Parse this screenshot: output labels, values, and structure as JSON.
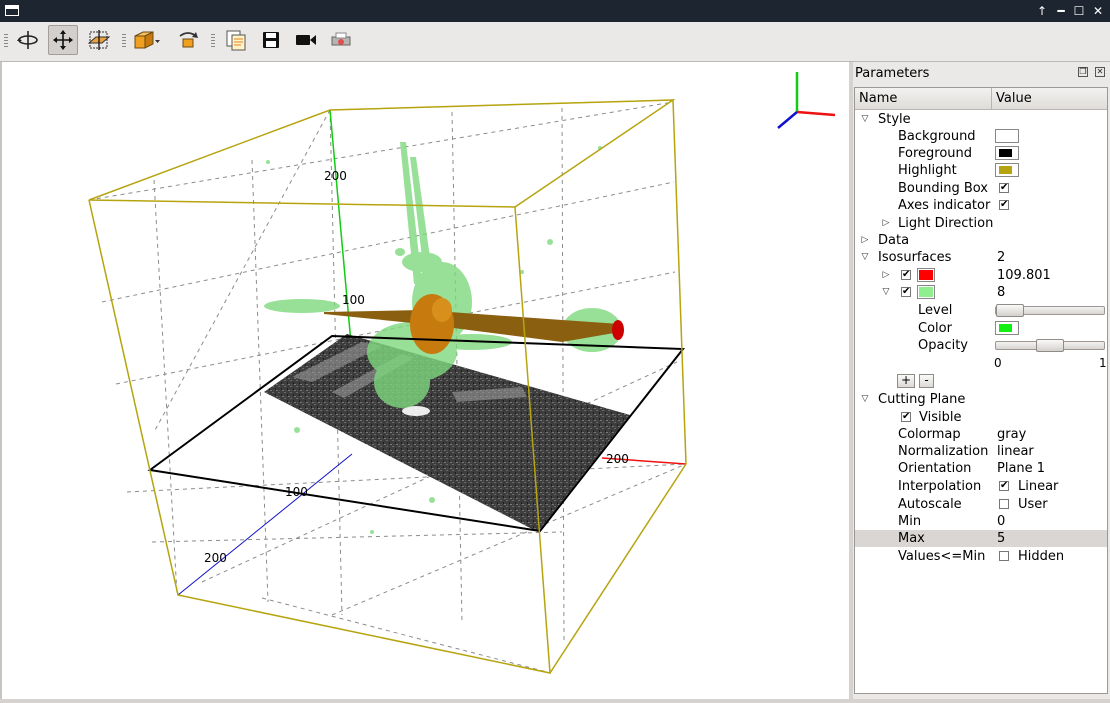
{
  "window": {
    "title": ""
  },
  "toolbar": {
    "icons": [
      "rotate-icon",
      "pan-icon",
      "zoom-box-icon",
      "cube-view-icon",
      "reset-view-icon",
      "copy-image-icon",
      "save-icon",
      "video-icon",
      "print-icon"
    ],
    "active": "pan-icon"
  },
  "viewport": {
    "axis_ticks": {
      "z_200": "200",
      "z_100": "100",
      "x_200": "200",
      "y_100": "100",
      "y_200": "200"
    },
    "colors": {
      "box": "#b6a40e",
      "plane_border": "#000000",
      "x_axis": "#ee1111",
      "y_axis": "#1111cc",
      "z_axis": "#11cc11",
      "iso_green": "#7fd97f",
      "iso_red": "#cc0000"
    }
  },
  "panel": {
    "title": "Parameters",
    "columns": {
      "name": "Name",
      "value": "Value"
    },
    "style": {
      "label": "Style",
      "background": "Background",
      "foreground": "Foreground",
      "highlight": "Highlight",
      "bounding_box": "Bounding Box",
      "axes_indicator": "Axes indicator",
      "light_direction": "Light Direction",
      "colors": {
        "background": "#ffffff",
        "foreground": "#000000",
        "highlight": "#b6a40e"
      }
    },
    "data": {
      "label": "Data"
    },
    "isosurfaces": {
      "label": "Isosurfaces",
      "count": "2",
      "items": [
        {
          "color": "#ff0000",
          "value": "109.801"
        },
        {
          "color": "#8fef8f",
          "value": "8"
        }
      ],
      "level": "Level",
      "color": "Color",
      "color_value": "#11ee11",
      "opacity": "Opacity",
      "opacity_min": "0",
      "opacity_max": "1",
      "opacity_fraction": 0.5,
      "add": "+",
      "remove": "-"
    },
    "cutting_plane": {
      "label": "Cutting Plane",
      "visible": "Visible",
      "colormap": "Colormap",
      "colormap_value": "gray",
      "normalization": "Normalization",
      "normalization_value": "linear",
      "orientation": "Orientation",
      "orientation_value": "Plane 1",
      "interpolation": "Interpolation",
      "interpolation_value": "Linear",
      "autoscale": "Autoscale",
      "autoscale_value": "User",
      "min": "Min",
      "min_value": "0",
      "max": "Max",
      "max_value": "5",
      "values_le_min": "Values<=Min",
      "values_le_min_value": "Hidden"
    }
  }
}
